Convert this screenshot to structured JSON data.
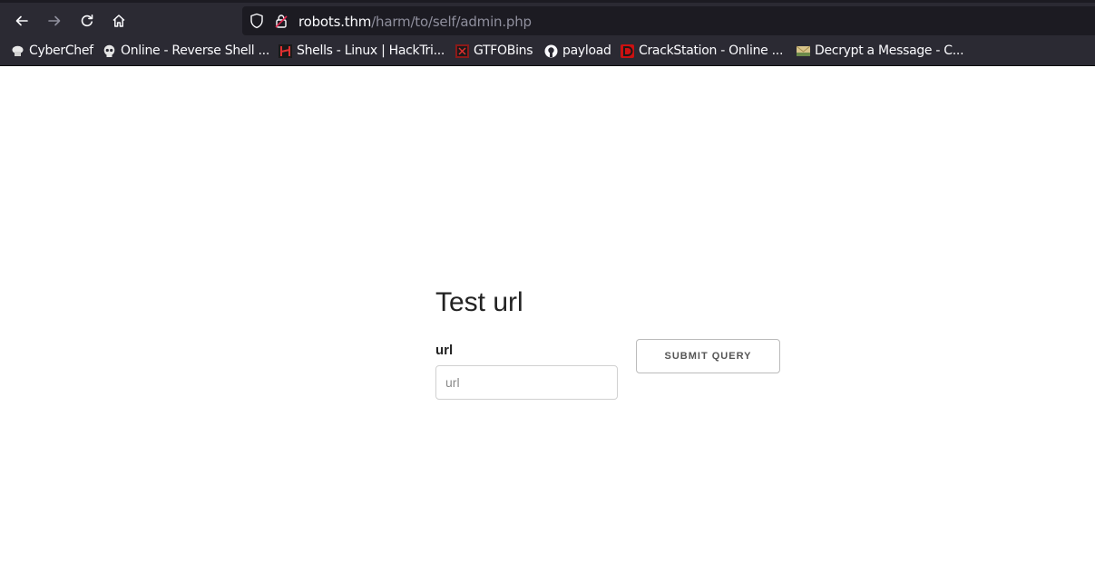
{
  "browser": {
    "url_host": "robots.thm",
    "url_path": "/harm/to/self/admin.php",
    "bookmarks": [
      {
        "label": "CyberChef",
        "icon": "chef-hat-icon"
      },
      {
        "label": "Online - Reverse Shell ...",
        "icon": "skull-icon"
      },
      {
        "label": "Shells - Linux | HackTri...",
        "icon": "hacktricks-icon"
      },
      {
        "label": "GTFOBins",
        "icon": "gtfobins-icon"
      },
      {
        "label": "payload",
        "icon": "github-icon"
      },
      {
        "label": "CrackStation - Online ...",
        "icon": "crackstation-icon"
      },
      {
        "label": "Decrypt a Message - C...",
        "icon": "envelope-icon"
      }
    ]
  },
  "page": {
    "title": "Test url",
    "field_label": "url",
    "input_placeholder": "url",
    "input_value": "",
    "submit_label": "SUBMIT QUERY"
  },
  "colors": {
    "chrome_bg": "#2b2a33",
    "urlbar_bg": "#1c1b22",
    "page_bg": "#ffffff"
  }
}
